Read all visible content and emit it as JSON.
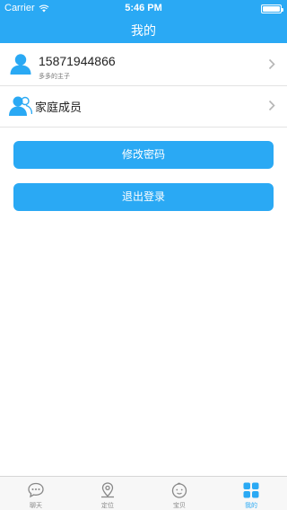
{
  "status_bar": {
    "carrier": "Carrier",
    "time": "5:46 PM",
    "battery_level_percent": 100
  },
  "nav": {
    "title": "我的"
  },
  "profile": {
    "phone": "15871944866",
    "subtitle": "多多的主子",
    "icon": "user-avatar-icon"
  },
  "family": {
    "label": "家庭成员",
    "icon": "family-members-icon"
  },
  "buttons": {
    "change_password": "修改密码",
    "logout": "退出登录"
  },
  "tabs": [
    {
      "label": "聊天",
      "icon": "chat-icon",
      "active": false
    },
    {
      "label": "定位",
      "icon": "location-icon",
      "active": false
    },
    {
      "label": "宝贝",
      "icon": "baby-icon",
      "active": false
    },
    {
      "label": "我的",
      "icon": "grid-icon",
      "active": true
    }
  ],
  "colors": {
    "accent": "#2aa9f4",
    "tab_inactive": "#888888",
    "divider": "#e3e3e3"
  }
}
